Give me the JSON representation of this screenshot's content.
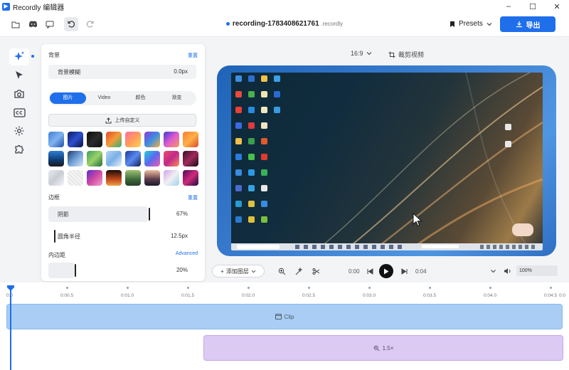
{
  "window": {
    "title": "Recordly 编辑器",
    "controls": [
      "–",
      "☐",
      "✕"
    ]
  },
  "toolbar": {
    "icons": [
      "folder-icon",
      "discord-icon",
      "chat-icon",
      "undo-icon",
      "redo-icon"
    ],
    "doc_name": "recording-1783408621761",
    "doc_ext": ".recordly",
    "presets_label": "Presets",
    "export_label": "导出",
    "accent": "#1f6feb"
  },
  "rail": {
    "icons": [
      "magic-icon",
      "cursor-icon",
      "camera-icon",
      "captions-icon",
      "settings-icon",
      "puzzle-icon"
    ]
  },
  "panel": {
    "background_title": "背景",
    "reset_label": "重置",
    "blur_label": "背景模糊",
    "blur_value": "0.0px",
    "tabs": [
      "图片",
      "Video",
      "颜色",
      "渐变"
    ],
    "active_tab": "图片",
    "upload_label": "上传自定义",
    "border_title": "边框",
    "border_reset": "重置",
    "shadow_label": "阴影",
    "shadow_value": "67%",
    "shadow_level": 0.67,
    "radius_label": "圆角半径",
    "radius_value": "12.5px",
    "padding_title": "内边距",
    "advanced_label": "Advanced",
    "padding_value": "20%",
    "padding_level": 0.2
  },
  "preview": {
    "aspect_ratio": "16:9",
    "crop_label": "裁剪视频"
  },
  "playback": {
    "add_layer_label": "添加图层",
    "current_time": "0:00",
    "total_time": "0:04",
    "zoom_level": "100%"
  },
  "timeline": {
    "ticks": [
      "0:0",
      "0:00.5",
      "0:01.0",
      "0:01.5",
      "0:02.0",
      "0:02.5",
      "0:03.0",
      "0:03.5",
      "0:04.0",
      "0:04.5",
      "0:0"
    ],
    "clip_label": "Clip",
    "zoom_label": "1.5×",
    "clip_color": "#a9cdf4",
    "zoom_color": "#dccaf3"
  }
}
